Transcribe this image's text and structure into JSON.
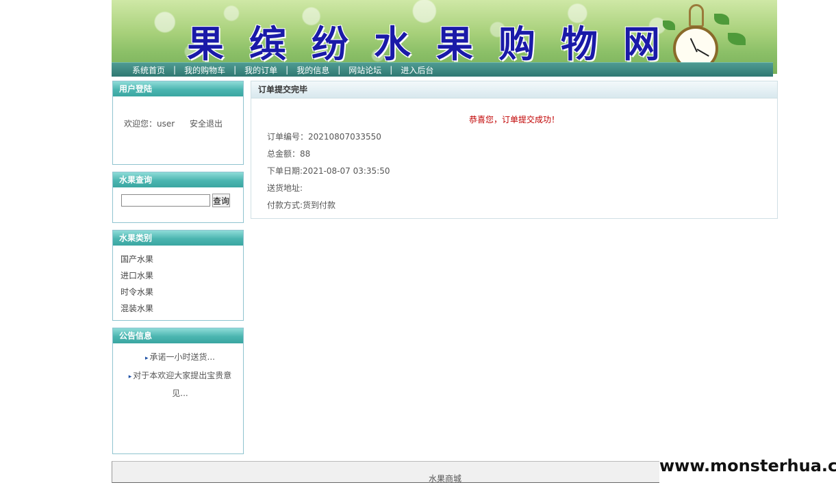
{
  "header": {
    "banner_title": "果缤纷水果购物网"
  },
  "nav": {
    "items": [
      {
        "label": "系统首页"
      },
      {
        "label": "我的购物车"
      },
      {
        "label": "我的订单"
      },
      {
        "label": "我的信息"
      },
      {
        "label": "网站论坛"
      },
      {
        "label": "进入后台"
      }
    ],
    "separator": "|"
  },
  "sidebar": {
    "login": {
      "title": "用户登陆",
      "welcome": "欢迎您：user",
      "logout": "安全退出"
    },
    "search": {
      "title": "水果查询",
      "input_value": "",
      "button_label": "查询"
    },
    "categories": {
      "title": "水果类别",
      "items": [
        "国产水果",
        "进口水果",
        "时令水果",
        "混装水果"
      ]
    },
    "notices": {
      "title": "公告信息",
      "items": [
        "承诺一小时送货...",
        "对于本欢迎大家提出宝贵意见..."
      ]
    }
  },
  "main": {
    "title": "订单提交完毕",
    "success_message": "恭喜您，订单提交成功！",
    "order_number": "订单编号：20210807033550",
    "total_amount": "总金额：88",
    "order_date": "下单日期:2021-08-07 03:35:50",
    "address": "送货地址:",
    "payment": "付款方式:货到付款"
  },
  "footer": {
    "text": "水果商城"
  },
  "watermark": "www.monsterhua.com",
  "colors": {
    "nav_bg": "#2f7872",
    "panel_head": "#4bb5b0",
    "banner_title": "#1a1aa8",
    "success": "#c00000"
  }
}
